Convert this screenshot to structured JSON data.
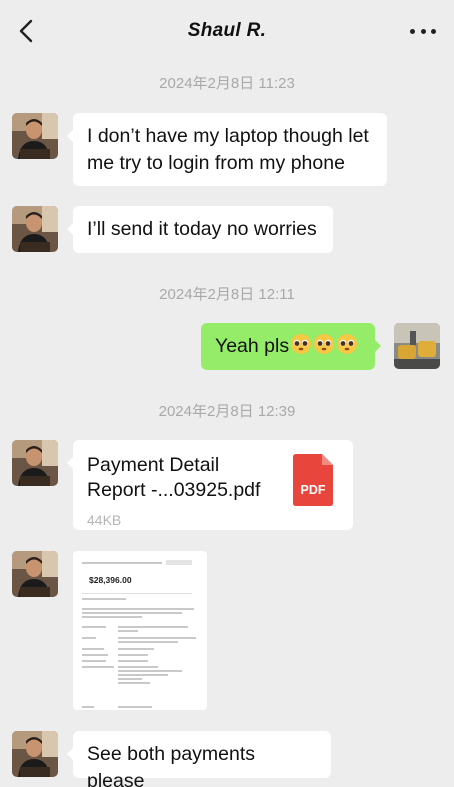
{
  "header": {
    "title": "Shaul R."
  },
  "messages": [
    {
      "type": "timestamp",
      "text": "2024年2月8日 11:23"
    },
    {
      "type": "text",
      "from": "Shaul R.",
      "text_line1": "I don’t have my laptop though let",
      "text_line2": "me try to login from my phone"
    },
    {
      "type": "text",
      "from": "Shaul R.",
      "text": "I’ll send it today no worries"
    },
    {
      "type": "timestamp",
      "text": "2024年2月8日 12:11"
    },
    {
      "type": "text",
      "from": "me",
      "text": "Yeah pls",
      "emoji": [
        "pleading-face",
        "pleading-face",
        "pleading-face"
      ]
    },
    {
      "type": "timestamp",
      "text": "2024年2月8日 12:39"
    },
    {
      "type": "file",
      "from": "Shaul R.",
      "name_line1": "Payment Detail",
      "name_line2": "Report -...03925.pdf",
      "size": "44KB",
      "file_badge": "PDF"
    },
    {
      "type": "image",
      "from": "Shaul R.",
      "amount": "$28,396.00"
    },
    {
      "type": "text",
      "from": "Shaul R.",
      "text": "See both payments please"
    }
  ],
  "colors": {
    "background": "#ededed",
    "incoming_bubble": "#ffffff",
    "outgoing_bubble": "#95ec69",
    "timestamp": "#a9a9a9",
    "pdf_badge": "#e8453c"
  }
}
